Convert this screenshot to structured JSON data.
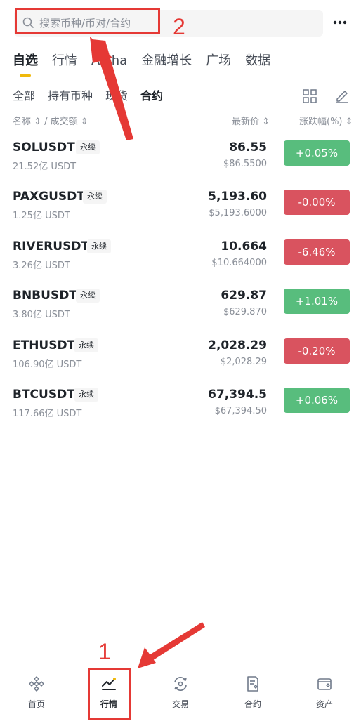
{
  "search": {
    "placeholder": "搜索币种/币对/合约"
  },
  "main_tabs": [
    "自选",
    "行情",
    "Alpha",
    "金融增长",
    "广场",
    "数据"
  ],
  "sub_tabs": [
    "全部",
    "持有币种",
    "现货",
    "合约"
  ],
  "header": {
    "name_vol": "名称 ⇕ / 成交额 ⇕",
    "last_price": "最新价 ⇕",
    "change": "涨跌幅(%) ⇕"
  },
  "rows": [
    {
      "symbol": "SOLUSDT",
      "tag": "永续",
      "volume": "21.52亿 USDT",
      "price": "86.55",
      "price_usd": "$86.5500",
      "change": "+0.05%",
      "direction": "up"
    },
    {
      "symbol": "PAXGUSDT",
      "tag": "永续",
      "volume": "1.25亿 USDT",
      "price": "5,193.60",
      "price_usd": "$5,193.6000",
      "change": "-0.00%",
      "direction": "down"
    },
    {
      "symbol": "RIVERUSDT",
      "tag": "永续",
      "volume": "3.26亿 USDT",
      "price": "10.664",
      "price_usd": "$10.664000",
      "change": "-6.46%",
      "direction": "down"
    },
    {
      "symbol": "BNBUSDT",
      "tag": "永续",
      "volume": "3.80亿 USDT",
      "price": "629.87",
      "price_usd": "$629.870",
      "change": "+1.01%",
      "direction": "up"
    },
    {
      "symbol": "ETHUSDT",
      "tag": "永续",
      "volume": "106.90亿 USDT",
      "price": "2,028.29",
      "price_usd": "$2,028.29",
      "change": "-0.20%",
      "direction": "down"
    },
    {
      "symbol": "BTCUSDT",
      "tag": "永续",
      "volume": "117.66亿 USDT",
      "price": "67,394.5",
      "price_usd": "$67,394.50",
      "change": "+0.06%",
      "direction": "up"
    }
  ],
  "bottom_nav": [
    "首页",
    "行情",
    "交易",
    "合约",
    "资产"
  ],
  "annotations": {
    "one": "1",
    "two": "2"
  },
  "colors": {
    "up": "#58bd7d",
    "down": "#d9535f",
    "accent": "#f0b90b",
    "annotation": "#e53935"
  }
}
